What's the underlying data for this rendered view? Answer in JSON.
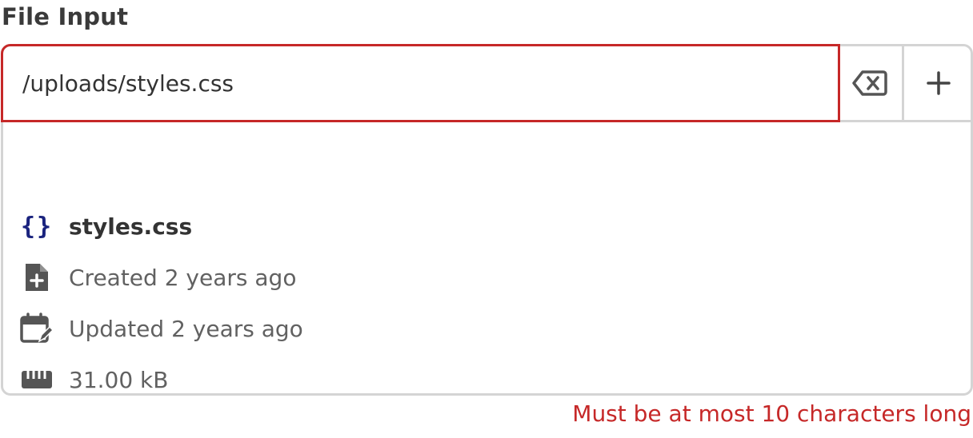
{
  "field": {
    "label": "File Input",
    "value": "/uploads/styles.css"
  },
  "actions": {
    "clear_icon": "backspace-clear-icon",
    "add_icon": "plus-icon"
  },
  "file": {
    "name": "styles.css",
    "type_icon": "code-braces-icon",
    "created": "Created 2 years ago",
    "updated": "Updated 2 years ago",
    "size": "31.00 kB"
  },
  "error": {
    "message": "Must be at most 10 characters long"
  },
  "colors": {
    "error": "#c62828",
    "border": "#d4d4d4",
    "icon": "#555555",
    "file_icon": "#1a237e"
  }
}
